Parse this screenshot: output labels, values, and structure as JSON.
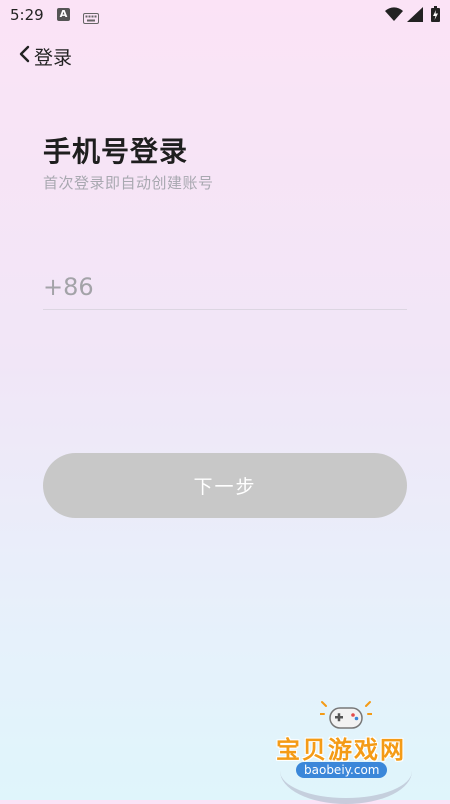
{
  "status_bar": {
    "time": "5:29",
    "a_badge": "A",
    "icons": [
      "keyboard-icon",
      "wifi-icon",
      "signal-icon",
      "battery-icon"
    ]
  },
  "header": {
    "back_icon": "chevron-left-icon",
    "title": "登录"
  },
  "main": {
    "title": "手机号登录",
    "subtitle": "首次登录即自动创建账号",
    "phone": {
      "country_code": "+86",
      "value": "",
      "placeholder": ""
    },
    "next_button_label": "下一步"
  },
  "watermark": {
    "title": "宝贝游戏网",
    "url": "baobeiy.com"
  },
  "colors": {
    "button_disabled": "#c8c8c8",
    "watermark_orange": "#f49b16",
    "watermark_blue": "#3b87d9"
  }
}
